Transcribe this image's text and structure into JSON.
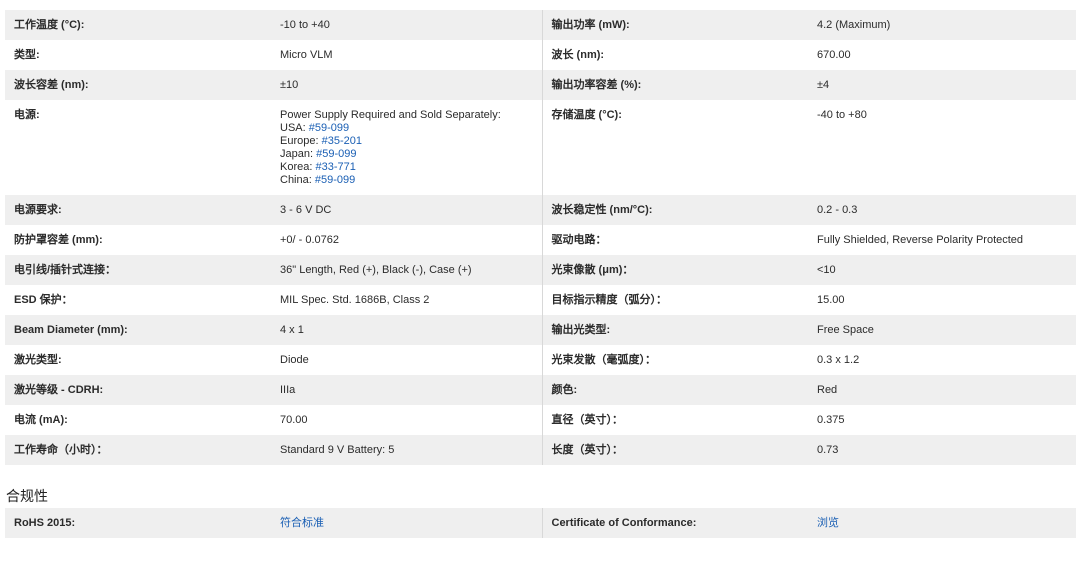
{
  "specs": [
    {
      "l1": "工作温度 (°C):",
      "v1": "-10 to +40",
      "l2": "输出功率 (mW):",
      "v2": "4.2 (Maximum)"
    },
    {
      "l1": "类型:",
      "v1": "Micro VLM",
      "l2": "波长 (nm):",
      "v2": "670.00"
    },
    {
      "l1": "波长容差 (nm):",
      "v1": "±10",
      "l2": "输出功率容差 (%):",
      "v2": "±4"
    },
    {
      "l1": "电源:",
      "v1": "Power Supply Required and Sold Separately:",
      "l2": "存储温度 (°C):",
      "v2": "-40 to +80"
    },
    {
      "l1": "电源要求:",
      "v1": "3 - 6 V DC",
      "l2": "波长稳定性 (nm/°C):",
      "v2": "0.2 - 0.3"
    },
    {
      "l1": "防护罩容差 (mm):",
      "v1": "+0/ - 0.0762",
      "l2": "驱动电路：",
      "v2": "Fully Shielded, Reverse Polarity Protected"
    },
    {
      "l1": "电引线/插针式连接：",
      "v1": "36\" Length, Red (+), Black (-), Case (+)",
      "l2": "光束像散 (μm)：",
      "v2": "<10"
    },
    {
      "l1": "ESD 保护：",
      "v1": "MIL Spec. Std. 1686B, Class 2",
      "l2": "目标指示精度（弧分）：",
      "v2": "15.00"
    },
    {
      "l1": "Beam Diameter (mm):",
      "v1": "4 x 1",
      "l2": "输出光类型:",
      "v2": "Free Space"
    },
    {
      "l1": "激光类型:",
      "v1": "Diode",
      "l2": "光束发散（毫弧度）：",
      "v2": "0.3 x 1.2"
    },
    {
      "l1": "激光等级 - CDRH:",
      "v1": "IIIa",
      "l2": "颜色:",
      "v2": "Red"
    },
    {
      "l1": "电流 (mA):",
      "v1": "70.00",
      "l2": "直径（英寸）：",
      "v2": "0.375"
    },
    {
      "l1": "工作寿命（小时）：",
      "v1": "Standard 9 V Battery: 5",
      "l2": "长度（英寸）：",
      "v2": "0.73"
    }
  ],
  "power_links": [
    {
      "region": "USA:",
      "part": "#59-099"
    },
    {
      "region": "Europe:",
      "part": "#35-201"
    },
    {
      "region": "Japan:",
      "part": "#59-099"
    },
    {
      "region": "Korea:",
      "part": "#33-771"
    },
    {
      "region": "China:",
      "part": "#59-099"
    }
  ],
  "compliance": {
    "title": "合规性",
    "rohs_label": "RoHS 2015:",
    "rohs_value": "符合标准",
    "cert_label": "Certificate of Conformance:",
    "cert_value": "浏览"
  },
  "colors": {
    "stripe": "#efefef",
    "link": "#1a5fb4",
    "divider": "#d8d8d8"
  }
}
